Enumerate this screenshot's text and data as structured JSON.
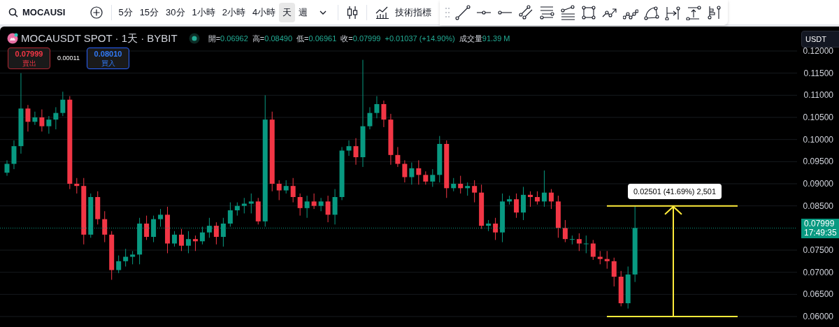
{
  "toolbar": {
    "symbol": "MOCAUSI",
    "intervals": [
      {
        "label": "5分",
        "selected": false
      },
      {
        "label": "15分",
        "selected": false
      },
      {
        "label": "30分",
        "selected": false
      },
      {
        "label": "1小時",
        "selected": false
      },
      {
        "label": "2小時",
        "selected": false
      },
      {
        "label": "4小時",
        "selected": false
      },
      {
        "label": "天",
        "selected": true
      },
      {
        "label": "週",
        "selected": false
      }
    ],
    "indicators": "技術指標"
  },
  "legend": {
    "title": "MOCAUSDT SPOT · 1天 · BYBIT",
    "ohlc": [
      {
        "label": "開=",
        "value": "0.06962"
      },
      {
        "label": "高=",
        "value": "0.08490"
      },
      {
        "label": "低=",
        "value": "0.06961"
      },
      {
        "label": "收=",
        "value": "0.07999"
      }
    ],
    "change": "+0.01037 (+14.90%)",
    "volume_label": "成交量",
    "volume": "91.39 M"
  },
  "trade": {
    "sell": {
      "price": "0.07999",
      "label": "賣出"
    },
    "spread": "0.00011",
    "buy": {
      "price": "0.08010",
      "label": "買入"
    }
  },
  "currency": "USDT",
  "price_axis": [
    "0.12000",
    "0.11500",
    "0.11000",
    "0.10500",
    "0.10000",
    "0.09500",
    "0.09000",
    "0.08500",
    "0.07500",
    "0.07000",
    "0.06500",
    "0.06000"
  ],
  "last_price": {
    "price": "0.07999",
    "countdown": "17:49:35"
  },
  "measure": {
    "label": "0.02501 (41.69%) 2,501"
  }
}
